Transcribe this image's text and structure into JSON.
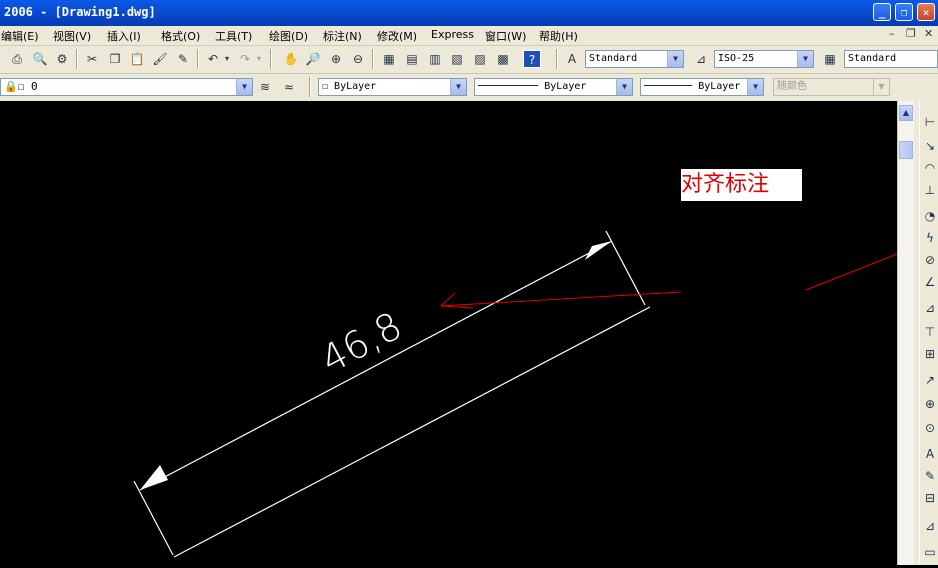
{
  "title": "2006 - [Drawing1.dwg]",
  "window_buttons": {
    "minimize": "_",
    "restore": "❐",
    "close": "✕"
  },
  "menu": [
    {
      "id": "edit",
      "label": "编辑(E)"
    },
    {
      "id": "view",
      "label": "视图(V)"
    },
    {
      "id": "insert",
      "label": "插入(I)"
    },
    {
      "id": "format",
      "label": "格式(O)"
    },
    {
      "id": "tools",
      "label": "工具(T)"
    },
    {
      "id": "draw",
      "label": "绘图(D)"
    },
    {
      "id": "dimension",
      "label": "标注(N)"
    },
    {
      "id": "modify",
      "label": "修改(M)"
    },
    {
      "id": "express",
      "label": "Express"
    },
    {
      "id": "window",
      "label": "窗口(W)"
    },
    {
      "id": "help",
      "label": "帮助(H)"
    }
  ],
  "mdi_buttons": {
    "minimize": "–",
    "restore": "❐",
    "close": "✕"
  },
  "styles_toolbar": {
    "text_style": "Standard",
    "dim_style": "ISO-25",
    "table_style": "Standard"
  },
  "layers_toolbar": {
    "layer": "0",
    "color": "ByLayer",
    "linetype": "ByLayer",
    "lineweight": "ByLayer",
    "plot_style": "随颜色"
  },
  "drawing": {
    "dimension_text": "46,8",
    "annotation": "对齐标注"
  },
  "colors": {
    "canvas": "#000000",
    "dimension": "#ffffff",
    "annotation": "#e00000",
    "titlebar": "#0a5ae8"
  }
}
